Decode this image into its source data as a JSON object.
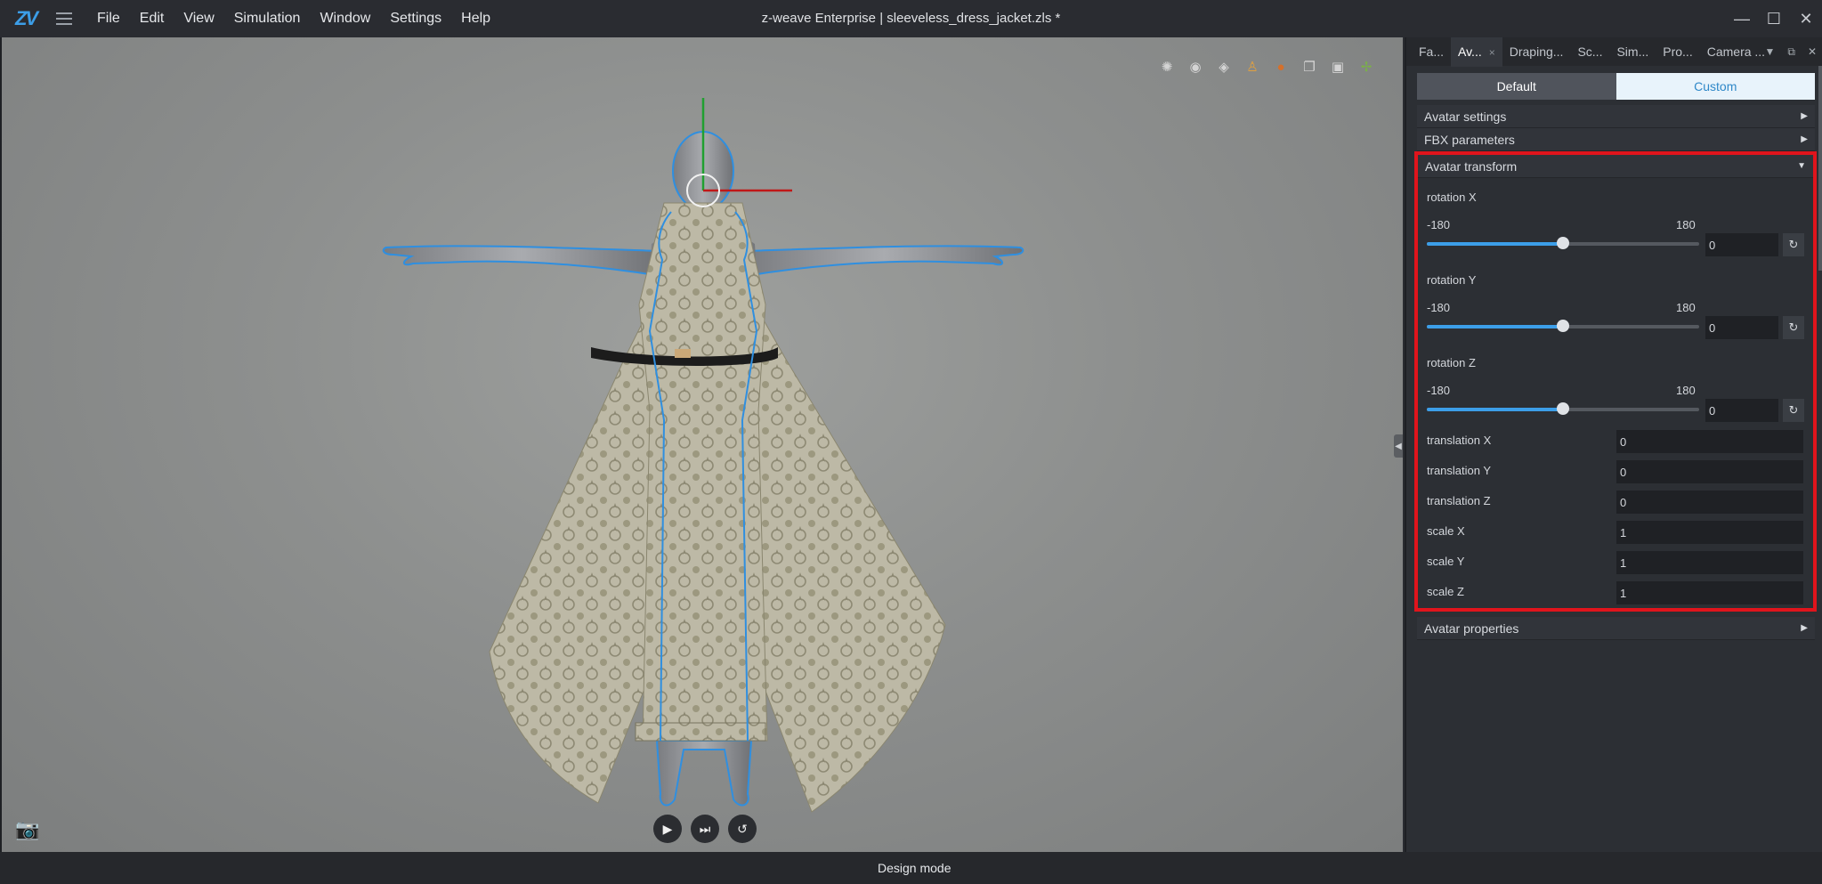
{
  "app": {
    "title": "z-weave Enterprise | sleeveless_dress_jacket.zls *",
    "logo_text": "ZV",
    "menu": [
      "File",
      "Edit",
      "View",
      "Simulation",
      "Window",
      "Settings",
      "Help"
    ]
  },
  "window_controls": {
    "minimize": "—",
    "maximize": "☐",
    "close": "✕"
  },
  "status": {
    "mode": "Design mode"
  },
  "panel": {
    "tabs": [
      {
        "label": "Fa...",
        "active": false
      },
      {
        "label": "Av...",
        "active": true,
        "close": "×"
      },
      {
        "label": "Draping...",
        "active": false
      },
      {
        "label": "Sc...",
        "active": false
      },
      {
        "label": "Sim...",
        "active": false
      },
      {
        "label": "Pro...",
        "active": false
      },
      {
        "label": "Camera ...",
        "active": false
      }
    ],
    "tab_extras": {
      "dropdown": "▼",
      "float": "⧉",
      "close": "✕"
    },
    "toggle": {
      "default_label": "Default",
      "custom_label": "Custom",
      "selected": "Custom"
    },
    "sections": {
      "avatar_settings": "Avatar settings",
      "fbx_parameters": "FBX parameters",
      "avatar_transform": "Avatar transform",
      "avatar_properties": "Avatar properties"
    },
    "arrows": {
      "collapsed": "▶",
      "expanded": "▼"
    },
    "transform": {
      "rotations": [
        {
          "label": "rotation X",
          "min": "-180",
          "max": "180",
          "value": "0",
          "fraction": 0.5
        },
        {
          "label": "rotation Y",
          "min": "-180",
          "max": "180",
          "value": "0",
          "fraction": 0.5
        },
        {
          "label": "rotation Z",
          "min": "-180",
          "max": "180",
          "value": "0",
          "fraction": 0.5
        }
      ],
      "fields": [
        {
          "label": "translation X",
          "value": "0"
        },
        {
          "label": "translation Y",
          "value": "0"
        },
        {
          "label": "translation Z",
          "value": "0"
        },
        {
          "label": "scale X",
          "value": "1"
        },
        {
          "label": "scale Y",
          "value": "1"
        },
        {
          "label": "scale Z",
          "value": "1"
        }
      ],
      "reset_icon": "↻"
    }
  },
  "viewport": {
    "tools": [
      "sun-icon",
      "sphere-icon",
      "layers-icon",
      "avatar-icon",
      "color-wheel-icon",
      "copy-icon",
      "frame-icon",
      "gizmo-icon"
    ],
    "tool_glyphs": [
      "✺",
      "◉",
      "◈",
      "♙",
      "●",
      "❐",
      "▣",
      "✢"
    ],
    "play_glyphs": {
      "play": "▶",
      "step": "⏭",
      "reset": "↺"
    },
    "camera_glyph": "📷",
    "collapse_glyph": "◀",
    "colors": {
      "selection_outline": "#2f8fe0",
      "gizmo_x": "#c01818",
      "gizmo_y": "#20a030",
      "fabric": "#b9b6a4"
    }
  }
}
